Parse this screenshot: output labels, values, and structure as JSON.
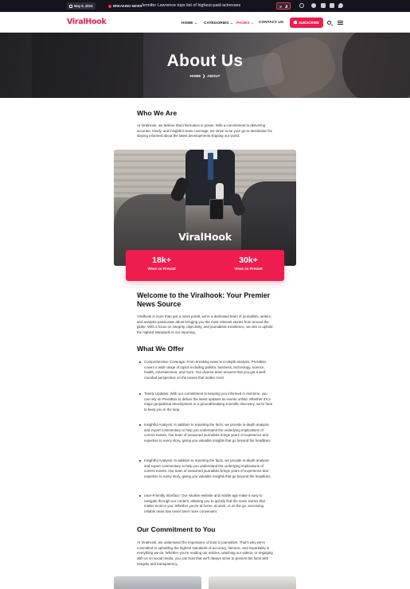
{
  "topbar": {
    "date": "May 8, 2024",
    "breaking_label": "BREAKING NEWS",
    "ticker": "Jennifer Lawrence tops list of highest-paid actresses"
  },
  "header": {
    "logo": "ViralHook",
    "nav": [
      {
        "label": "HOME",
        "has_caret": true,
        "active": false
      },
      {
        "label": "CATEGORIES",
        "has_caret": true,
        "active": false
      },
      {
        "label": "PAGES",
        "has_caret": true,
        "active": true
      },
      {
        "label": "CONTACT US",
        "has_caret": false,
        "active": false
      }
    ],
    "subscribe_label": "SUBSCRIBE"
  },
  "hero": {
    "title": "About Us",
    "breadcrumb_home": "HOME",
    "breadcrumb_separator": "❯",
    "breadcrumb_current": "ABOUT"
  },
  "who": {
    "heading": "Who We Are",
    "text": "At ViralHook, we believe that information is power. With a commitment to delivering accurate, timely, and insightful news coverage, we strive to be your go-to destination for staying informed about the latest developments shaping our world."
  },
  "photo": {
    "brand": "ViralHook"
  },
  "stats": [
    {
      "value": "18k+",
      "label": "Views on Firewatt"
    },
    {
      "value": "30k+",
      "label": "Views on Firewatt"
    }
  ],
  "welcome": {
    "heading": "Welcome to the Viralhook: Your Premier News Source",
    "text": "Viralhook is more than just a news portal; we're a dedicated team of journalists, writers, and analysts passionate about bringing you the most relevant stories from around the globe. With a focus on integrity, objectivity, and journalistic excellence, we aim to uphold the highest standards in our reporting."
  },
  "offer": {
    "heading": "What We Offer",
    "items": [
      "Comprehensive Coverage: From breaking news to in-depth analysis, PressBox covers a wide range of topics including politics, business, technology, science, health, entertainment, and more. Our diverse team ensures that you get a well-rounded perspective on the issues that matter most.",
      "Timely Updates: With our commitment to keeping you informed in real-time, you can rely on PressBox to deliver the latest updates as events unfold. Whether it's a major geopolitical development or a groundbreaking scientific discovery, we're here to keep you in the loop.",
      "Insightful Analysis: In addition to reporting the facts, we provide in-depth analysis and expert commentary to help you understand the underlying implications of current events. Our team of seasoned journalists brings years of experience and expertise to every story, giving you valuable insights that go beyond the headlines.",
      "Insightful Analysis: In addition to reporting the facts, we provide in-depth analysis and expert commentary to help you understand the underlying implications of current events. Our team of seasoned journalists brings years of experience and expertise to every story, giving you valuable insights that go beyond the headlines.",
      "User-Friendly Interface: Our intuitive website and mobile app make it easy to navigate through our content, allowing you to quickly find the news stories that matter most to you. Whether you're at home, at work, or on the go, accessing reliable news has never been more convenient."
    ]
  },
  "commitment": {
    "heading": "Our Commitment to You",
    "text": "At ViralHook, we understand the importance of trust in journalism. That's why we're committed to upholding the highest standards of accuracy, fairness, and impartiality in everything we do. Whether you're reading our articles, watching our videos, or engaging with us on social media, you can trust that we'll always strive to present the facts with integrity and transparency."
  },
  "colors": {
    "brand": "#ee1d4e",
    "topbar": "#15131c"
  }
}
